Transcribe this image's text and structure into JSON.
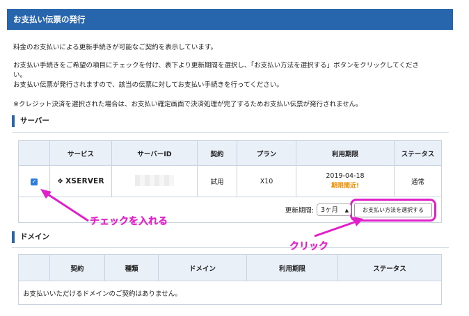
{
  "header": {
    "title": "お支払い伝票の発行"
  },
  "intro": {
    "line1": "料金のお支払いによる更新手続きが可能なご契約を表示しています。",
    "line2": "お支払い手続きをご希望の項目にチェックを付け、表下より更新期間を選択し、「お支払い方法を選択する」ボタンをクリックしてくださ",
    "line2b": "い。",
    "line3": "お支払い伝票が発行されますので、該当の伝票に対してお支払い手続きを行ってください。",
    "line4": "※クレジット決済を選択された場合は、お支払い確定画面で決済処理が完了するためお支払い伝票が発行されません。"
  },
  "server_section": {
    "title": "サーバー",
    "columns": [
      "",
      "サービス",
      "サーバーID",
      "契約",
      "プラン",
      "利用期限",
      "ステータス"
    ],
    "rows": [
      {
        "checked": true,
        "service": "XSERVER",
        "server_id": "",
        "contract": "試用",
        "plan": "X10",
        "expiry": "2019-04-18",
        "expiry_note": "期限間近!",
        "status": "通常"
      }
    ],
    "renew_label": "更新期間:",
    "renew_value": "3ヶ月",
    "pay_button": "お支払い方法を選択する"
  },
  "domain_section": {
    "title": "ドメイン",
    "columns": [
      "",
      "契約",
      "種類",
      "ドメイン",
      "利用期限",
      "ステータス"
    ],
    "empty_message": "お支払いいただけるドメインのご契約はありません。"
  },
  "annotations": {
    "check_note": "チェックを入れる",
    "click_note": "クリック"
  },
  "colors": {
    "header": "#2766ad",
    "annotation": "#e020c8",
    "warning": "#f08f00"
  }
}
